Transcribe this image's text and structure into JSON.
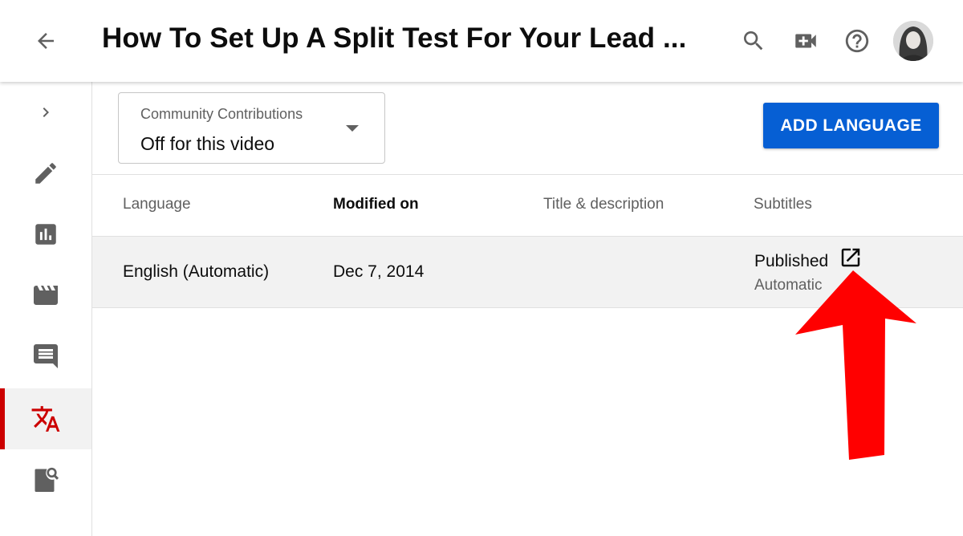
{
  "header": {
    "title": "How To Set Up A Split Test For Your Lead ...",
    "icons": [
      "back-arrow-icon",
      "search-icon",
      "create-video-icon",
      "help-icon",
      "avatar"
    ]
  },
  "sidebar": {
    "items": [
      {
        "name": "expand",
        "icon": "chevron-right-icon"
      },
      {
        "name": "details",
        "icon": "pencil-icon"
      },
      {
        "name": "analytics",
        "icon": "analytics-icon"
      },
      {
        "name": "editor",
        "icon": "clapperboard-icon"
      },
      {
        "name": "comments",
        "icon": "comment-icon"
      },
      {
        "name": "subtitles",
        "icon": "translate-icon",
        "active": true
      },
      {
        "name": "copyright",
        "icon": "copyright-search-icon"
      }
    ]
  },
  "toolbar": {
    "community_label": "Community Contributions",
    "community_value": "Off for this video",
    "add_language_label": "ADD LANGUAGE"
  },
  "table": {
    "headers": {
      "language": "Language",
      "modified": "Modified on",
      "title_desc": "Title & description",
      "subtitles": "Subtitles"
    },
    "rows": [
      {
        "language": "English (Automatic)",
        "modified": "Dec 7, 2014",
        "title_desc": "",
        "subtitles_status": "Published",
        "subtitles_type": "Automatic"
      }
    ]
  },
  "colors": {
    "accent_blue": "#065fd4",
    "active_red": "#cc0000",
    "annotation_arrow": "#ff0000"
  }
}
